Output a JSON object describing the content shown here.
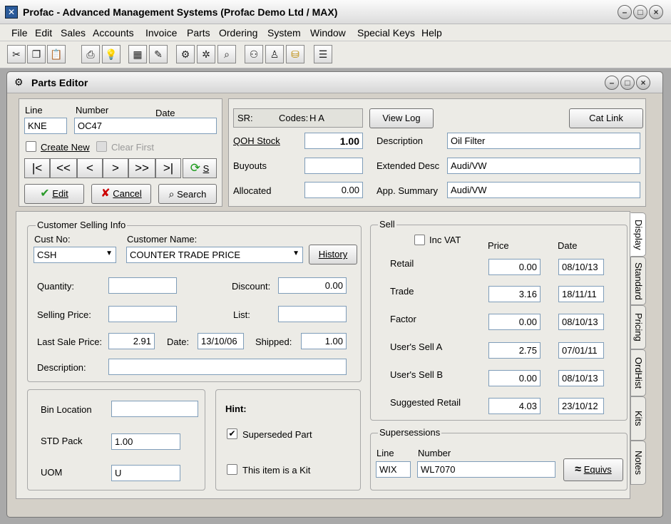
{
  "window": {
    "title": "Profac - Advanced Management Systems (Profac Demo Ltd / MAX)"
  },
  "menu": [
    "File",
    "Edit",
    "Sales",
    "Accounts",
    "Invoice",
    "Parts",
    "Ordering",
    "System",
    "Window",
    "Special Keys",
    "Help"
  ],
  "child": {
    "title": "Parts Editor"
  },
  "part": {
    "line_label": "Line",
    "number_label": "Number",
    "date_label": "Date",
    "line": "KNE",
    "number": "OC47",
    "date": "",
    "create_new": "Create New",
    "clear_first": "Clear First",
    "nav": [
      "|<",
      "<<",
      "<",
      ">",
      ">>",
      ">|"
    ],
    "s_label": "S",
    "edit": "Edit",
    "cancel": "Cancel",
    "search": "Search"
  },
  "info": {
    "sr_label": "SR:",
    "codes_label": "Codes:",
    "codes_value": "H A",
    "view_log": "View Log",
    "cat_link": "Cat Link",
    "qoh_label": "QOH Stock",
    "qoh_value": "1.00",
    "buyouts_label": "Buyouts",
    "buyouts_value": "",
    "allocated_label": "Allocated",
    "allocated_value": "0.00",
    "desc_label": "Description",
    "desc_value": "Oil Filter",
    "ext_label": "Extended Desc",
    "ext_value": "Audi/VW",
    "app_label": "App. Summary",
    "app_value": "Audi/VW"
  },
  "customer": {
    "group": "Customer Selling Info",
    "cust_no_label": "Cust No:",
    "cust_no": "CSH",
    "name_label": "Customer Name:",
    "name": "COUNTER TRADE PRICE",
    "history": "History",
    "quantity_label": "Quantity:",
    "quantity": "",
    "discount_label": "Discount:",
    "discount": "0.00",
    "selling_label": "Selling Price:",
    "selling": "",
    "list_label": "List:",
    "list": "",
    "last_label": "Last Sale Price:",
    "last": "2.91",
    "date_label": "Date:",
    "date": "13/10/06",
    "shipped_label": "Shipped:",
    "shipped": "1.00",
    "desc_label": "Description:",
    "desc": ""
  },
  "bin": {
    "bin_label": "Bin Location",
    "bin": "",
    "std_label": "STD Pack",
    "std": "1.00",
    "uom_label": "UOM",
    "uom": "U"
  },
  "hint": {
    "title": "Hint:",
    "superseded": "Superseded Part",
    "kit": "This item is a Kit"
  },
  "sell": {
    "group": "Sell",
    "inc_vat": "Inc VAT",
    "price_label": "Price",
    "date_label": "Date",
    "rows": [
      {
        "label": "Retail",
        "price": "0.00",
        "date": "08/10/13"
      },
      {
        "label": "Trade",
        "price": "3.16",
        "date": "18/11/11"
      },
      {
        "label": "Factor",
        "price": "0.00",
        "date": "08/10/13"
      },
      {
        "label": "User's Sell A",
        "price": "2.75",
        "date": "07/01/11"
      },
      {
        "label": "User's Sell B",
        "price": "0.00",
        "date": "08/10/13"
      },
      {
        "label": "Suggested Retail",
        "price": "4.03",
        "date": "23/10/12"
      }
    ]
  },
  "supersessions": {
    "group": "Supersessions",
    "line_label": "Line",
    "number_label": "Number",
    "line": "WIX",
    "number": "WL7070",
    "equivs": "Equivs"
  },
  "tabs": [
    "Display",
    "Standard",
    "Pricing",
    "OrdHist",
    "Kits",
    "Notes"
  ]
}
